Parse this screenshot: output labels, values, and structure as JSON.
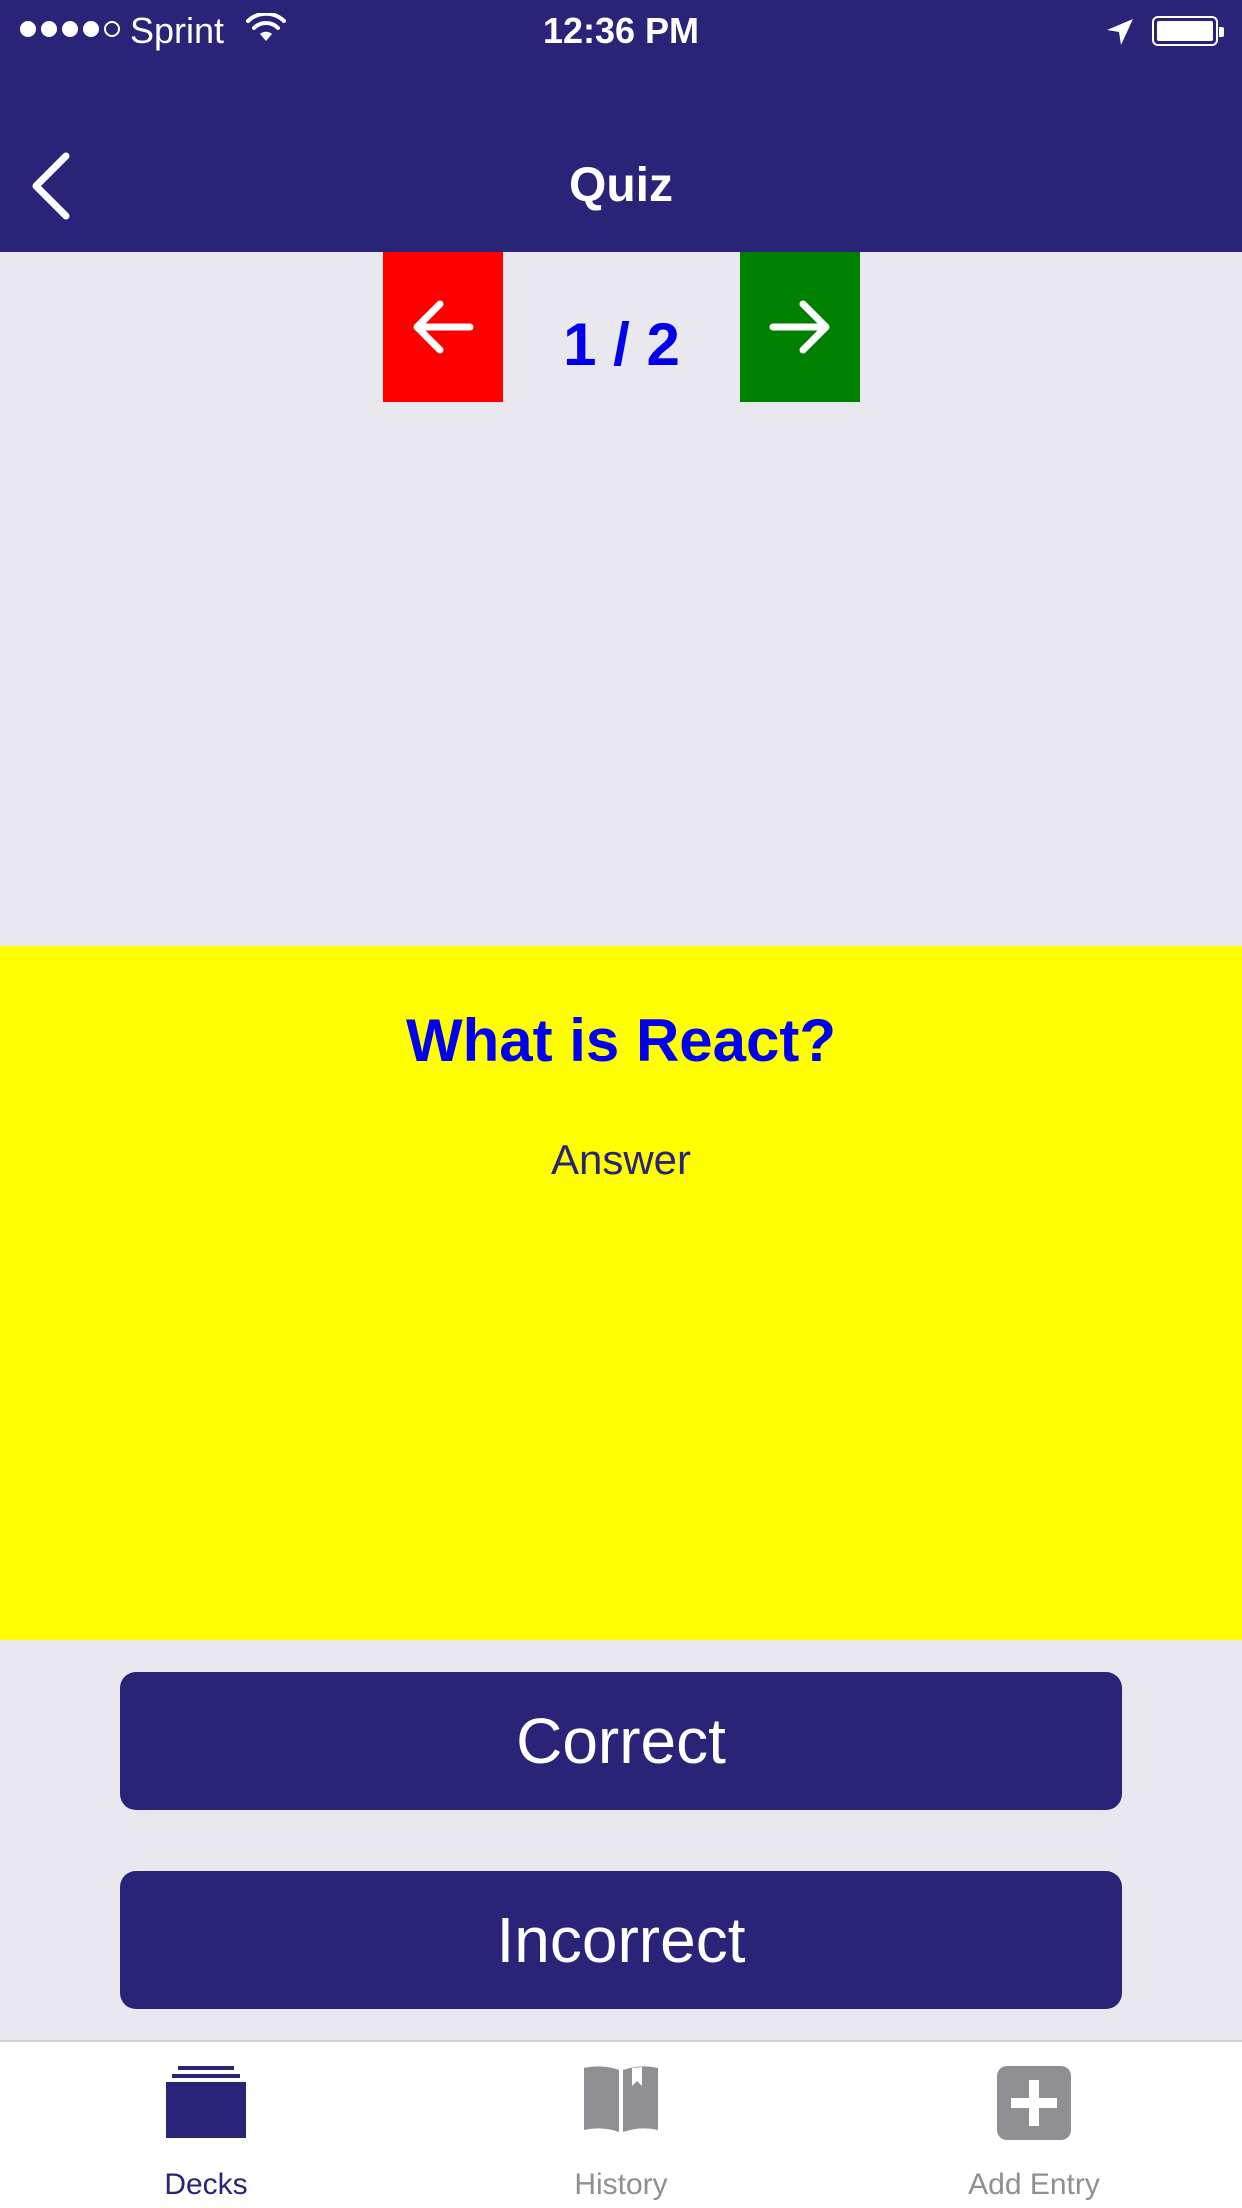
{
  "status_bar": {
    "carrier": "Sprint",
    "time": "12:36 PM",
    "signal_bars": 4,
    "signal_total": 5,
    "battery_icon": "battery-full-icon",
    "wifi_icon": "wifi-icon",
    "location_icon": "location-arrow-icon"
  },
  "nav": {
    "title": "Quiz",
    "back_icon": "chevron-left-icon"
  },
  "quiz": {
    "counter": "1 / 2",
    "prev_icon": "arrow-left-icon",
    "next_icon": "arrow-right-icon",
    "prev_color": "#ff0000",
    "next_color": "#008000"
  },
  "card": {
    "question": "What is React?",
    "toggle_label": "Answer",
    "background": "#ffff00"
  },
  "actions": {
    "correct_label": "Correct",
    "incorrect_label": "Incorrect"
  },
  "tabs": [
    {
      "label": "Decks",
      "icon": "decks-icon",
      "active": true
    },
    {
      "label": "History",
      "icon": "book-icon",
      "active": false
    },
    {
      "label": "Add Entry",
      "icon": "plus-box-icon",
      "active": false
    }
  ],
  "colors": {
    "primary": "#2a2478",
    "accent_text": "#0000ee",
    "inactive_tab": "#8e8e93",
    "background": "#e9e8ef"
  }
}
